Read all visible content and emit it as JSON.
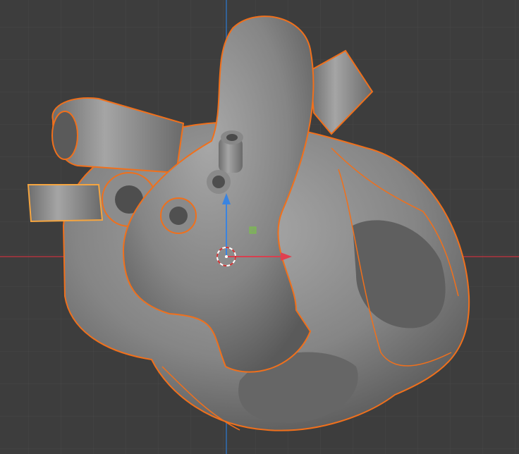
{
  "viewport": {
    "mode": "3D Viewport",
    "background_color": "#3d3d3d",
    "grid_color": "#484848",
    "x_axis_color": "#b0353f",
    "z_axis_color": "#2f6fb5",
    "selection_outline_color": "#f0701c",
    "active_outline_color": "#f5a540",
    "mesh_color": "#8a8a8a"
  },
  "objects": [
    {
      "name": "heart",
      "selected": true
    },
    {
      "name": "vessel",
      "selected": true,
      "active": true
    }
  ],
  "gizmo": {
    "type": "translate",
    "icons": [
      "3d-cursor-icon",
      "move-x-arrow-icon",
      "move-z-arrow-icon",
      "move-plane-handle-icon"
    ]
  }
}
